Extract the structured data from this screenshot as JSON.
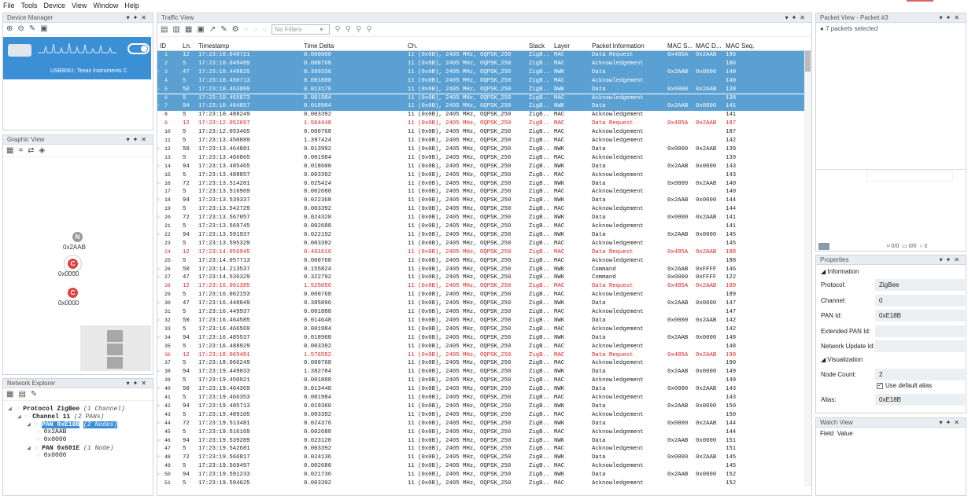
{
  "menu": [
    "File",
    "Tools",
    "Device",
    "View",
    "Window",
    "Help"
  ],
  "device_manager": {
    "title": "Device Manager",
    "device_name": "USB9061: Texas Instruments C"
  },
  "graphic_view": {
    "title": "Graphic View",
    "nodes": [
      {
        "letter": "N",
        "label": "0x2AAB",
        "color": "#9a9a9a"
      },
      {
        "letter": "C",
        "label": "0x0000",
        "color": "#e04040"
      },
      {
        "letter": "C",
        "label": "0x0000",
        "color": "#e04040"
      }
    ]
  },
  "network_explorer": {
    "title": "Network Explorer",
    "tree": [
      {
        "text": "Protocol ZigBee",
        "note": "(1 Channel)",
        "level": 0
      },
      {
        "text": "Channel 11",
        "note": "(2 PANs)",
        "level": 1
      },
      {
        "text": "PAN 0xE18B",
        "note": "(2 Nodes)",
        "level": 2,
        "selected": true
      },
      {
        "text": "0x2AAB",
        "note": "",
        "level": 3
      },
      {
        "text": "0x0000",
        "note": "",
        "level": 3
      },
      {
        "text": "PAN 0x601E",
        "note": "(1 Node)",
        "level": 2
      },
      {
        "text": "0x0000",
        "note": "",
        "level": 3
      }
    ]
  },
  "traffic_view": {
    "title": "Traffic View",
    "filter_placeholder": "No Filters",
    "columns": [
      "ID",
      "Ln.",
      "Timestamp",
      "Time Delta",
      "Ch.",
      "Stack",
      "Layer",
      "Packet Information",
      "MAC S...",
      "MAC D...",
      "MAC Seq."
    ],
    "rows": [
      [
        "1",
        "12",
        "17:23:10.048721",
        "0.000000",
        "11 (0x0B), 2405 MHz, OQPSK_250",
        "ZigB..",
        "MAC",
        "Data Request",
        "0x485A",
        "0x2AAB",
        "186",
        "s",
        ""
      ],
      [
        "2",
        "5",
        "17:23:10.049489",
        "0.000768",
        "11 (0x0B), 2405 MHz, OQPSK_250",
        "ZigB..",
        "MAC",
        "Acknowledgement",
        "",
        "",
        "186",
        "s",
        ""
      ],
      [
        "3",
        "47",
        "17:23:10.448825",
        "0.399336",
        "11 (0x0B), 2405 MHz, OQPSK_250",
        "ZigB..",
        "NWK",
        "Data",
        "0x2AAB",
        "0x0000",
        "140",
        "s",
        "f"
      ],
      [
        "4",
        "5",
        "17:23:10.450713",
        "0.001888",
        "11 (0x0B), 2405 MHz, OQPSK_250",
        "ZigB..",
        "MAC",
        "Acknowledgement",
        "",
        "",
        "140",
        "s",
        ""
      ],
      [
        "5",
        "50",
        "17:23:10.463889",
        "0.013176",
        "11 (0x0B), 2405 MHz, OQPSK_250",
        "ZigB..",
        "NWK",
        "Data",
        "0x0000",
        "0x2AAB",
        "138",
        "s",
        "f"
      ],
      [
        "6",
        "5",
        "17:23:10.465873",
        "0.001984",
        "11 (0x0B), 2405 MHz, OQPSK_250",
        "ZigB..",
        "MAC",
        "Acknowledgement",
        "",
        "",
        "138",
        "s",
        ""
      ],
      [
        "7",
        "94",
        "17:23:10.484857",
        "0.018984",
        "11 (0x0B), 2405 MHz, OQPSK_250",
        "ZigB..",
        "NWK",
        "Data",
        "0x2AAB",
        "0x0000",
        "141",
        "s",
        "f"
      ],
      [
        "8",
        "5",
        "17:23:10.488249",
        "0.003392",
        "11 (0x0B), 2405 MHz, OQPSK_250",
        "ZigB..",
        "MAC",
        "Acknowledgement",
        "",
        "",
        "141",
        "",
        ""
      ],
      [
        "9",
        "12",
        "17:23:12.052697",
        "1.564448",
        "11 (0x0B), 2405 MHz, OQPSK_250",
        "ZigB..",
        "MAC",
        "Data Request",
        "0x485A",
        "0x2AAB",
        "187",
        "r",
        ""
      ],
      [
        "10",
        "5",
        "17:23:12.053465",
        "0.000768",
        "11 (0x0B), 2405 MHz, OQPSK_250",
        "ZigB..",
        "MAC",
        "Acknowledgement",
        "",
        "",
        "187",
        "",
        ""
      ],
      [
        "11",
        "5",
        "17:23:13.450889",
        "1.397424",
        "11 (0x0B), 2405 MHz, OQPSK_250",
        "ZigB..",
        "MAC",
        "Acknowledgement",
        "",
        "",
        "142",
        "",
        ""
      ],
      [
        "12",
        "50",
        "17:23:13.464881",
        "0.013992",
        "11 (0x0B), 2405 MHz, OQPSK_250",
        "ZigB..",
        "NWK",
        "Data",
        "0x0000",
        "0x2AAB",
        "139",
        "",
        "f"
      ],
      [
        "13",
        "5",
        "17:23:13.466865",
        "0.001984",
        "11 (0x0B), 2405 MHz, OQPSK_250",
        "ZigB..",
        "MAC",
        "Acknowledgement",
        "",
        "",
        "139",
        "",
        ""
      ],
      [
        "14",
        "94",
        "17:23:13.485465",
        "0.018600",
        "11 (0x0B), 2405 MHz, OQPSK_250",
        "ZigB..",
        "NWK",
        "Data",
        "0x2AAB",
        "0x0000",
        "143",
        "",
        "f"
      ],
      [
        "15",
        "5",
        "17:23:13.488857",
        "0.003392",
        "11 (0x0B), 2405 MHz, OQPSK_250",
        "ZigB..",
        "MAC",
        "Acknowledgement",
        "",
        "",
        "143",
        "",
        ""
      ],
      [
        "16",
        "72",
        "17:23:13.514281",
        "0.025424",
        "11 (0x0B), 2405 MHz, OQPSK_250",
        "ZigB..",
        "NWK",
        "Data",
        "0x0000",
        "0x2AAB",
        "140",
        "",
        "f"
      ],
      [
        "17",
        "5",
        "17:23:13.516969",
        "0.002688",
        "11 (0x0B), 2405 MHz, OQPSK_250",
        "ZigB..",
        "MAC",
        "Acknowledgement",
        "",
        "",
        "140",
        "",
        ""
      ],
      [
        "18",
        "94",
        "17:23:13.539337",
        "0.022368",
        "11 (0x0B), 2405 MHz, OQPSK_250",
        "ZigB..",
        "NWK",
        "Data",
        "0x2AAB",
        "0x0000",
        "144",
        "",
        "f"
      ],
      [
        "19",
        "5",
        "17:23:13.542729",
        "0.003392",
        "11 (0x0B), 2405 MHz, OQPSK_250",
        "ZigB..",
        "MAC",
        "Acknowledgement",
        "",
        "",
        "144",
        "",
        ""
      ],
      [
        "20",
        "72",
        "17:23:13.567057",
        "0.024328",
        "11 (0x0B), 2405 MHz, OQPSK_250",
        "ZigB..",
        "NWK",
        "Data",
        "0x0000",
        "0x2AAB",
        "141",
        "",
        "f"
      ],
      [
        "21",
        "5",
        "17:23:13.569745",
        "0.002688",
        "11 (0x0B), 2405 MHz, OQPSK_250",
        "ZigB..",
        "MAC",
        "Acknowledgement",
        "",
        "",
        "141",
        "",
        ""
      ],
      [
        "22",
        "94",
        "17:23:13.591937",
        "0.022192",
        "11 (0x0B), 2405 MHz, OQPSK_250",
        "ZigB..",
        "NWK",
        "Data",
        "0x2AAB",
        "0x0000",
        "145",
        "",
        "f"
      ],
      [
        "23",
        "5",
        "17:23:13.595329",
        "0.003392",
        "11 (0x0B), 2405 MHz, OQPSK_250",
        "ZigB..",
        "MAC",
        "Acknowledgement",
        "",
        "",
        "145",
        "",
        ""
      ],
      [
        "24",
        "12",
        "17:23:14.056945",
        "0.461616",
        "11 (0x0B), 2405 MHz, OQPSK_250",
        "ZigB..",
        "MAC",
        "Data Request",
        "0x485A",
        "0x2AAB",
        "188",
        "r",
        ""
      ],
      [
        "25",
        "5",
        "17:23:14.057713",
        "0.000768",
        "11 (0x0B), 2405 MHz, OQPSK_250",
        "ZigB..",
        "MAC",
        "Acknowledgement",
        "",
        "",
        "188",
        "",
        ""
      ],
      [
        "26",
        "50",
        "17:23:14.213537",
        "0.155824",
        "11 (0x0B), 2405 MHz, OQPSK_250",
        "ZigB..",
        "NWK",
        "Command",
        "0x2AAB",
        "0xFFFF",
        "146",
        "",
        "f"
      ],
      [
        "27",
        "47",
        "17:23:14.536329",
        "0.322792",
        "11 (0x0B), 2405 MHz, OQPSK_250",
        "ZigB..",
        "NWK",
        "Command",
        "0x0000",
        "0xFFFF",
        "122",
        "",
        "f"
      ],
      [
        "28",
        "12",
        "17:23:16.061385",
        "1.525056",
        "11 (0x0B), 2405 MHz, OQPSK_250",
        "ZigB..",
        "MAC",
        "Data Request",
        "0x485A",
        "0x2AAB",
        "189",
        "r",
        ""
      ],
      [
        "29",
        "5",
        "17:23:16.062153",
        "0.000768",
        "11 (0x0B), 2405 MHz, OQPSK_250",
        "ZigB..",
        "MAC",
        "Acknowledgement",
        "",
        "",
        "189",
        "",
        ""
      ],
      [
        "30",
        "47",
        "17:23:16.448049",
        "0.385896",
        "11 (0x0B), 2405 MHz, OQPSK_250",
        "ZigB..",
        "NWK",
        "Data",
        "0x2AAB",
        "0x0000",
        "147",
        "",
        "f"
      ],
      [
        "31",
        "5",
        "17:23:16.449937",
        "0.001888",
        "11 (0x0B), 2405 MHz, OQPSK_250",
        "ZigB..",
        "MAC",
        "Acknowledgement",
        "",
        "",
        "147",
        "",
        ""
      ],
      [
        "32",
        "50",
        "17:23:16.464585",
        "0.014648",
        "11 (0x0B), 2405 MHz, OQPSK_250",
        "ZigB..",
        "NWK",
        "Data",
        "0x0000",
        "0x2AAB",
        "142",
        "",
        "f"
      ],
      [
        "33",
        "5",
        "17:23:16.466569",
        "0.001984",
        "11 (0x0B), 2405 MHz, OQPSK_250",
        "ZigB..",
        "MAC",
        "Acknowledgement",
        "",
        "",
        "142",
        "",
        ""
      ],
      [
        "34",
        "94",
        "17:23:16.485537",
        "0.018968",
        "11 (0x0B), 2405 MHz, OQPSK_250",
        "ZigB..",
        "NWK",
        "Data",
        "0x2AAB",
        "0x0000",
        "148",
        "",
        "f"
      ],
      [
        "35",
        "5",
        "17:23:16.488929",
        "0.003392",
        "11 (0x0B), 2405 MHz, OQPSK_250",
        "ZigB..",
        "MAC",
        "Acknowledgement",
        "",
        "",
        "148",
        "",
        ""
      ],
      [
        "36",
        "12",
        "17:23:18.065481",
        "1.576552",
        "11 (0x0B), 2405 MHz, OQPSK_250",
        "ZigB..",
        "MAC",
        "Data Request",
        "0x485A",
        "0x2AAB",
        "190",
        "r",
        ""
      ],
      [
        "37",
        "5",
        "17:23:18.066249",
        "0.000768",
        "11 (0x0B), 2405 MHz, OQPSK_250",
        "ZigB..",
        "MAC",
        "Acknowledgement",
        "",
        "",
        "190",
        "",
        ""
      ],
      [
        "38",
        "94",
        "17:23:19.449033",
        "1.382784",
        "11 (0x0B), 2405 MHz, OQPSK_250",
        "ZigB..",
        "NWK",
        "Data",
        "0x2AAB",
        "0x0000",
        "149",
        "",
        "f"
      ],
      [
        "39",
        "5",
        "17:23:19.450921",
        "0.001888",
        "11 (0x0B), 2405 MHz, OQPSK_250",
        "ZigB..",
        "MAC",
        "Acknowledgement",
        "",
        "",
        "149",
        "",
        ""
      ],
      [
        "40",
        "50",
        "17:23:19.464369",
        "0.013448",
        "11 (0x0B), 2405 MHz, OQPSK_250",
        "ZigB..",
        "NWK",
        "Data",
        "0x0000",
        "0x2AAB",
        "143",
        "",
        "f"
      ],
      [
        "41",
        "5",
        "17:23:19.466353",
        "0.001984",
        "11 (0x0B), 2405 MHz, OQPSK_250",
        "ZigB..",
        "MAC",
        "Acknowledgement",
        "",
        "",
        "143",
        "",
        ""
      ],
      [
        "42",
        "94",
        "17:23:19.485713",
        "0.019360",
        "11 (0x0B), 2405 MHz, OQPSK_250",
        "ZigB..",
        "NWK",
        "Data",
        "0x2AAB",
        "0x0000",
        "150",
        "",
        "f"
      ],
      [
        "43",
        "5",
        "17:23:19.489105",
        "0.003392",
        "11 (0x0B), 2405 MHz, OQPSK_250",
        "ZigB..",
        "MAC",
        "Acknowledgement",
        "",
        "",
        "150",
        "",
        ""
      ],
      [
        "44",
        "72",
        "17:23:19.513481",
        "0.024376",
        "11 (0x0B), 2405 MHz, OQPSK_250",
        "ZigB..",
        "NWK",
        "Data",
        "0x0000",
        "0x2AAB",
        "144",
        "",
        "f"
      ],
      [
        "45",
        "5",
        "17:23:19.516169",
        "0.002688",
        "11 (0x0B), 2405 MHz, OQPSK_250",
        "ZigB..",
        "MAC",
        "Acknowledgement",
        "",
        "",
        "144",
        "",
        ""
      ],
      [
        "46",
        "94",
        "17:23:19.539289",
        "0.023120",
        "11 (0x0B), 2405 MHz, OQPSK_250",
        "ZigB..",
        "NWK",
        "Data",
        "0x2AAB",
        "0x0000",
        "151",
        "",
        "f"
      ],
      [
        "47",
        "5",
        "17:23:19.542681",
        "0.003392",
        "11 (0x0B), 2405 MHz, OQPSK_250",
        "ZigB..",
        "MAC",
        "Acknowledgement",
        "",
        "",
        "151",
        "",
        ""
      ],
      [
        "48",
        "72",
        "17:23:19.566817",
        "0.024136",
        "11 (0x0B), 2405 MHz, OQPSK_250",
        "ZigB..",
        "NWK",
        "Data",
        "0x0000",
        "0x2AAB",
        "145",
        "",
        "f"
      ],
      [
        "49",
        "5",
        "17:23:19.569497",
        "0.002680",
        "11 (0x0B), 2405 MHz, OQPSK_250",
        "ZigB..",
        "MAC",
        "Acknowledgement",
        "",
        "",
        "145",
        "",
        ""
      ],
      [
        "50",
        "94",
        "17:23:19.591233",
        "0.021736",
        "11 (0x0B), 2405 MHz, OQPSK_250",
        "ZigB..",
        "NWK",
        "Data",
        "0x2AAB",
        "0x0000",
        "152",
        "",
        "f"
      ],
      [
        "51",
        "5",
        "17:23:19.594625",
        "0.003392",
        "11 (0x0B), 2405 MHz, OQPSK_250",
        "ZigB..",
        "MAC",
        "Acknowledgement",
        "",
        "",
        "152",
        "",
        ""
      ]
    ]
  },
  "packet_view": {
    "title": "Packet View - Packet #3",
    "selected_text": "7 packets selected",
    "counters": [
      "0/0",
      "0/0",
      "0"
    ]
  },
  "properties": {
    "title": "Properties",
    "info_label": "Information",
    "items": [
      {
        "k": "Protocol:",
        "v": "ZigBee"
      },
      {
        "k": "Channel:",
        "v": "0"
      },
      {
        "k": "PAN Id:",
        "v": "0xE18B"
      },
      {
        "k": "Extended PAN Id:",
        "v": ""
      },
      {
        "k": "Network Update Id:",
        "v": ""
      }
    ],
    "viz_label": "Visualization",
    "node_count_label": "Node Count:",
    "node_count": "2",
    "use_default_alias": "Use default alias",
    "alias_label": "Alias:",
    "alias": "0xE18B"
  },
  "watch_view": {
    "title": "Watch View",
    "field": "Field",
    "value": "Value"
  }
}
